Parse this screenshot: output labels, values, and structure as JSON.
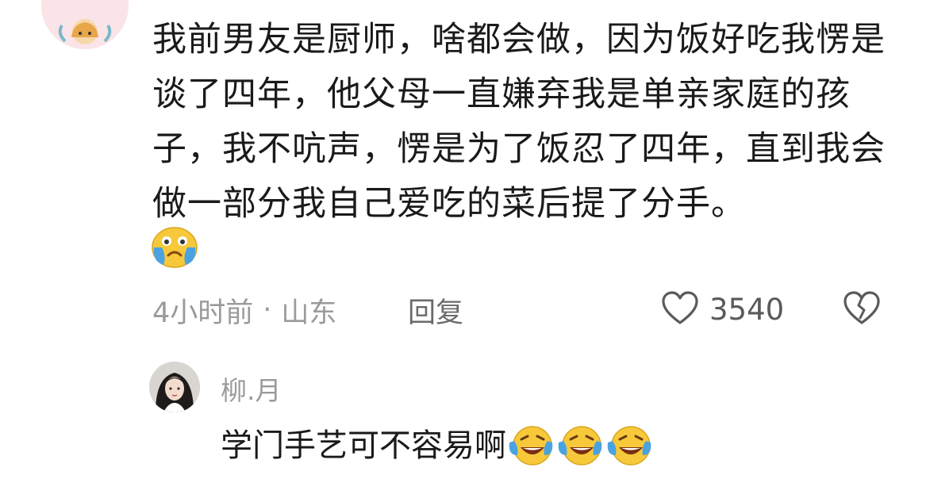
{
  "comment": {
    "text": "我前男友是厨师，啥都会做，因为饭好吃我愣是谈了四年，他父母一直嫌弃我是单亲家庭的孩子，我不吭声，愣是为了饭忍了四年，直到我会做一部分我自己爱吃的菜后提了分手。",
    "emoji": "crying-face-emoji",
    "time": "4小时前",
    "separator": "·",
    "location": "山东",
    "reply_label": "回复",
    "like_count": "3540",
    "like_icon": "heart-outline-icon",
    "dislike_icon": "broken-heart-icon"
  },
  "reply": {
    "author": "柳.月",
    "text": "学门手艺可不容易啊",
    "emojis": [
      "laughing-crying-emoji",
      "laughing-crying-emoji",
      "laughing-crying-emoji"
    ]
  },
  "colors": {
    "text_primary": "#1a1a1a",
    "text_secondary": "#9a9a9a",
    "avatar_bg": "#fbe4e8",
    "emoji_yellow": "#f7c93a",
    "emoji_tears": "#4aa3e0"
  }
}
